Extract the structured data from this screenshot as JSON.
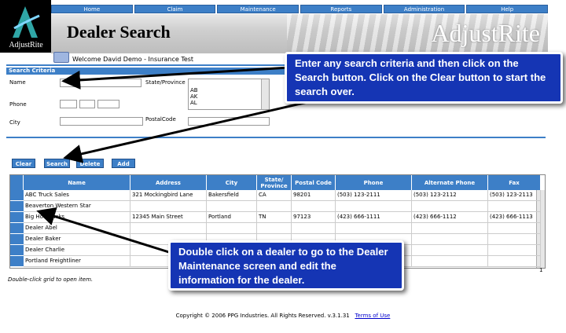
{
  "header": {
    "logo_text": "AdjustRite",
    "nav": [
      "Home",
      "Claim",
      "Maintenance",
      "Reports",
      "Administration",
      "Help"
    ],
    "page_title": "Dealer Search",
    "brand": "AdjustRite",
    "welcome": "Welcome David Demo - Insurance Test"
  },
  "search": {
    "section_title": "Search Criteria",
    "labels": {
      "name": "Name",
      "phone": "Phone",
      "city": "City",
      "state": "State/Province",
      "postal": "PostalCode"
    },
    "state_options": [
      "AB",
      "AK",
      "AL"
    ]
  },
  "buttons": {
    "clear": "Clear",
    "search": "Search",
    "delete": "Delete",
    "add": "Add"
  },
  "grid": {
    "columns": [
      "Name",
      "Address",
      "City",
      "State/ Province",
      "Postal Code",
      "Phone",
      "Alternate Phone",
      "Fax"
    ],
    "rows": [
      [
        "ABC Truck Sales",
        "321 Mockingbird Lane",
        "Bakersfield",
        "CA",
        "98201",
        "(503) 123-2111",
        "(503) 123-2112",
        "(503) 123-2113"
      ],
      [
        "Beaverton Western Star",
        "",
        "",
        "",
        "",
        "",
        "",
        ""
      ],
      [
        "Big Hot Trucks",
        "12345 Main Street",
        "Portland",
        "TN",
        "97123",
        "(423) 666-1111",
        "(423) 666-1112",
        "(423) 666-1113"
      ],
      [
        "Dealer Abel",
        "",
        "",
        "",
        "",
        "",
        "",
        ""
      ],
      [
        "Dealer Baker",
        "",
        "",
        "",
        "",
        "",
        "",
        ""
      ],
      [
        "Dealer Charlie",
        "",
        "",
        "",
        "",
        "",
        "",
        ""
      ],
      [
        "Portland Freightliner",
        "",
        "",
        "",
        "",
        "",
        "",
        ""
      ]
    ],
    "page": "1",
    "hint": "Double-click grid to open item."
  },
  "footer": {
    "copyright": "Copyright © 2006 PPG Industries. All Rights Reserved. v.3.1.31",
    "terms": "Terms of Use"
  },
  "callouts": {
    "top": "Enter any search criteria and then click on the Search button.  Click on the Clear button to start the search over.",
    "bottom": "Double click on a dealer to go to the Dealer Maintenance screen and edit the information for the dealer."
  },
  "colors": {
    "accent": "#3d7fc7",
    "callout": "#1535b4"
  }
}
